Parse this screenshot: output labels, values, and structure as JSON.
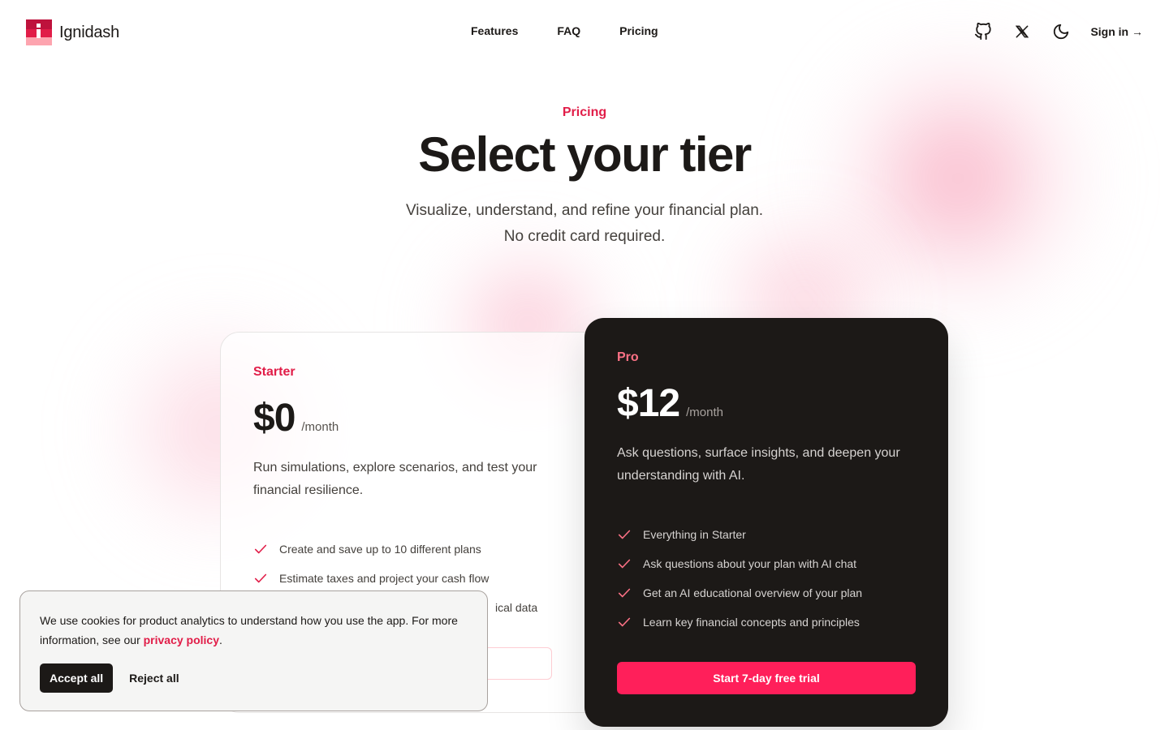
{
  "brand": {
    "name": "Ignidash"
  },
  "nav": {
    "items": [
      "Features",
      "FAQ",
      "Pricing"
    ]
  },
  "header": {
    "signin_label": "Sign in →"
  },
  "icons": {
    "github": "github-icon",
    "x": "x-twitter-icon",
    "theme": "moon-icon",
    "check": "check-icon"
  },
  "colors": {
    "accent": "#e11d48",
    "pro_button": "#ff1f5a",
    "dark_card": "#1c1917"
  },
  "hero": {
    "eyebrow": "Pricing",
    "title": "Select your tier",
    "subtitle_line1": "Visualize, understand, and refine your financial plan.",
    "subtitle_line2": "No credit card required."
  },
  "starter": {
    "name": "Starter",
    "price": "$0",
    "period": "/month",
    "description": "Run simulations, explore scenarios, and test your financial resilience.",
    "features": [
      "Create and save up to 10 different plans",
      "Estimate taxes and project your cash flow",
      "ical data"
    ]
  },
  "pro": {
    "name": "Pro",
    "price": "$12",
    "period": "/month",
    "description": "Ask questions, surface insights, and deepen your understanding with AI.",
    "features": [
      "Everything in Starter",
      "Ask questions about your plan with AI chat",
      "Get an AI educational overview of your plan",
      "Learn key financial concepts and principles"
    ],
    "cta": "Start 7-day free trial"
  },
  "cookie": {
    "text": "We use cookies for product analytics to understand how you use the app. For more information, see our ",
    "link": "privacy policy",
    "text_end": ".",
    "accept": "Accept all",
    "reject": "Reject all"
  }
}
